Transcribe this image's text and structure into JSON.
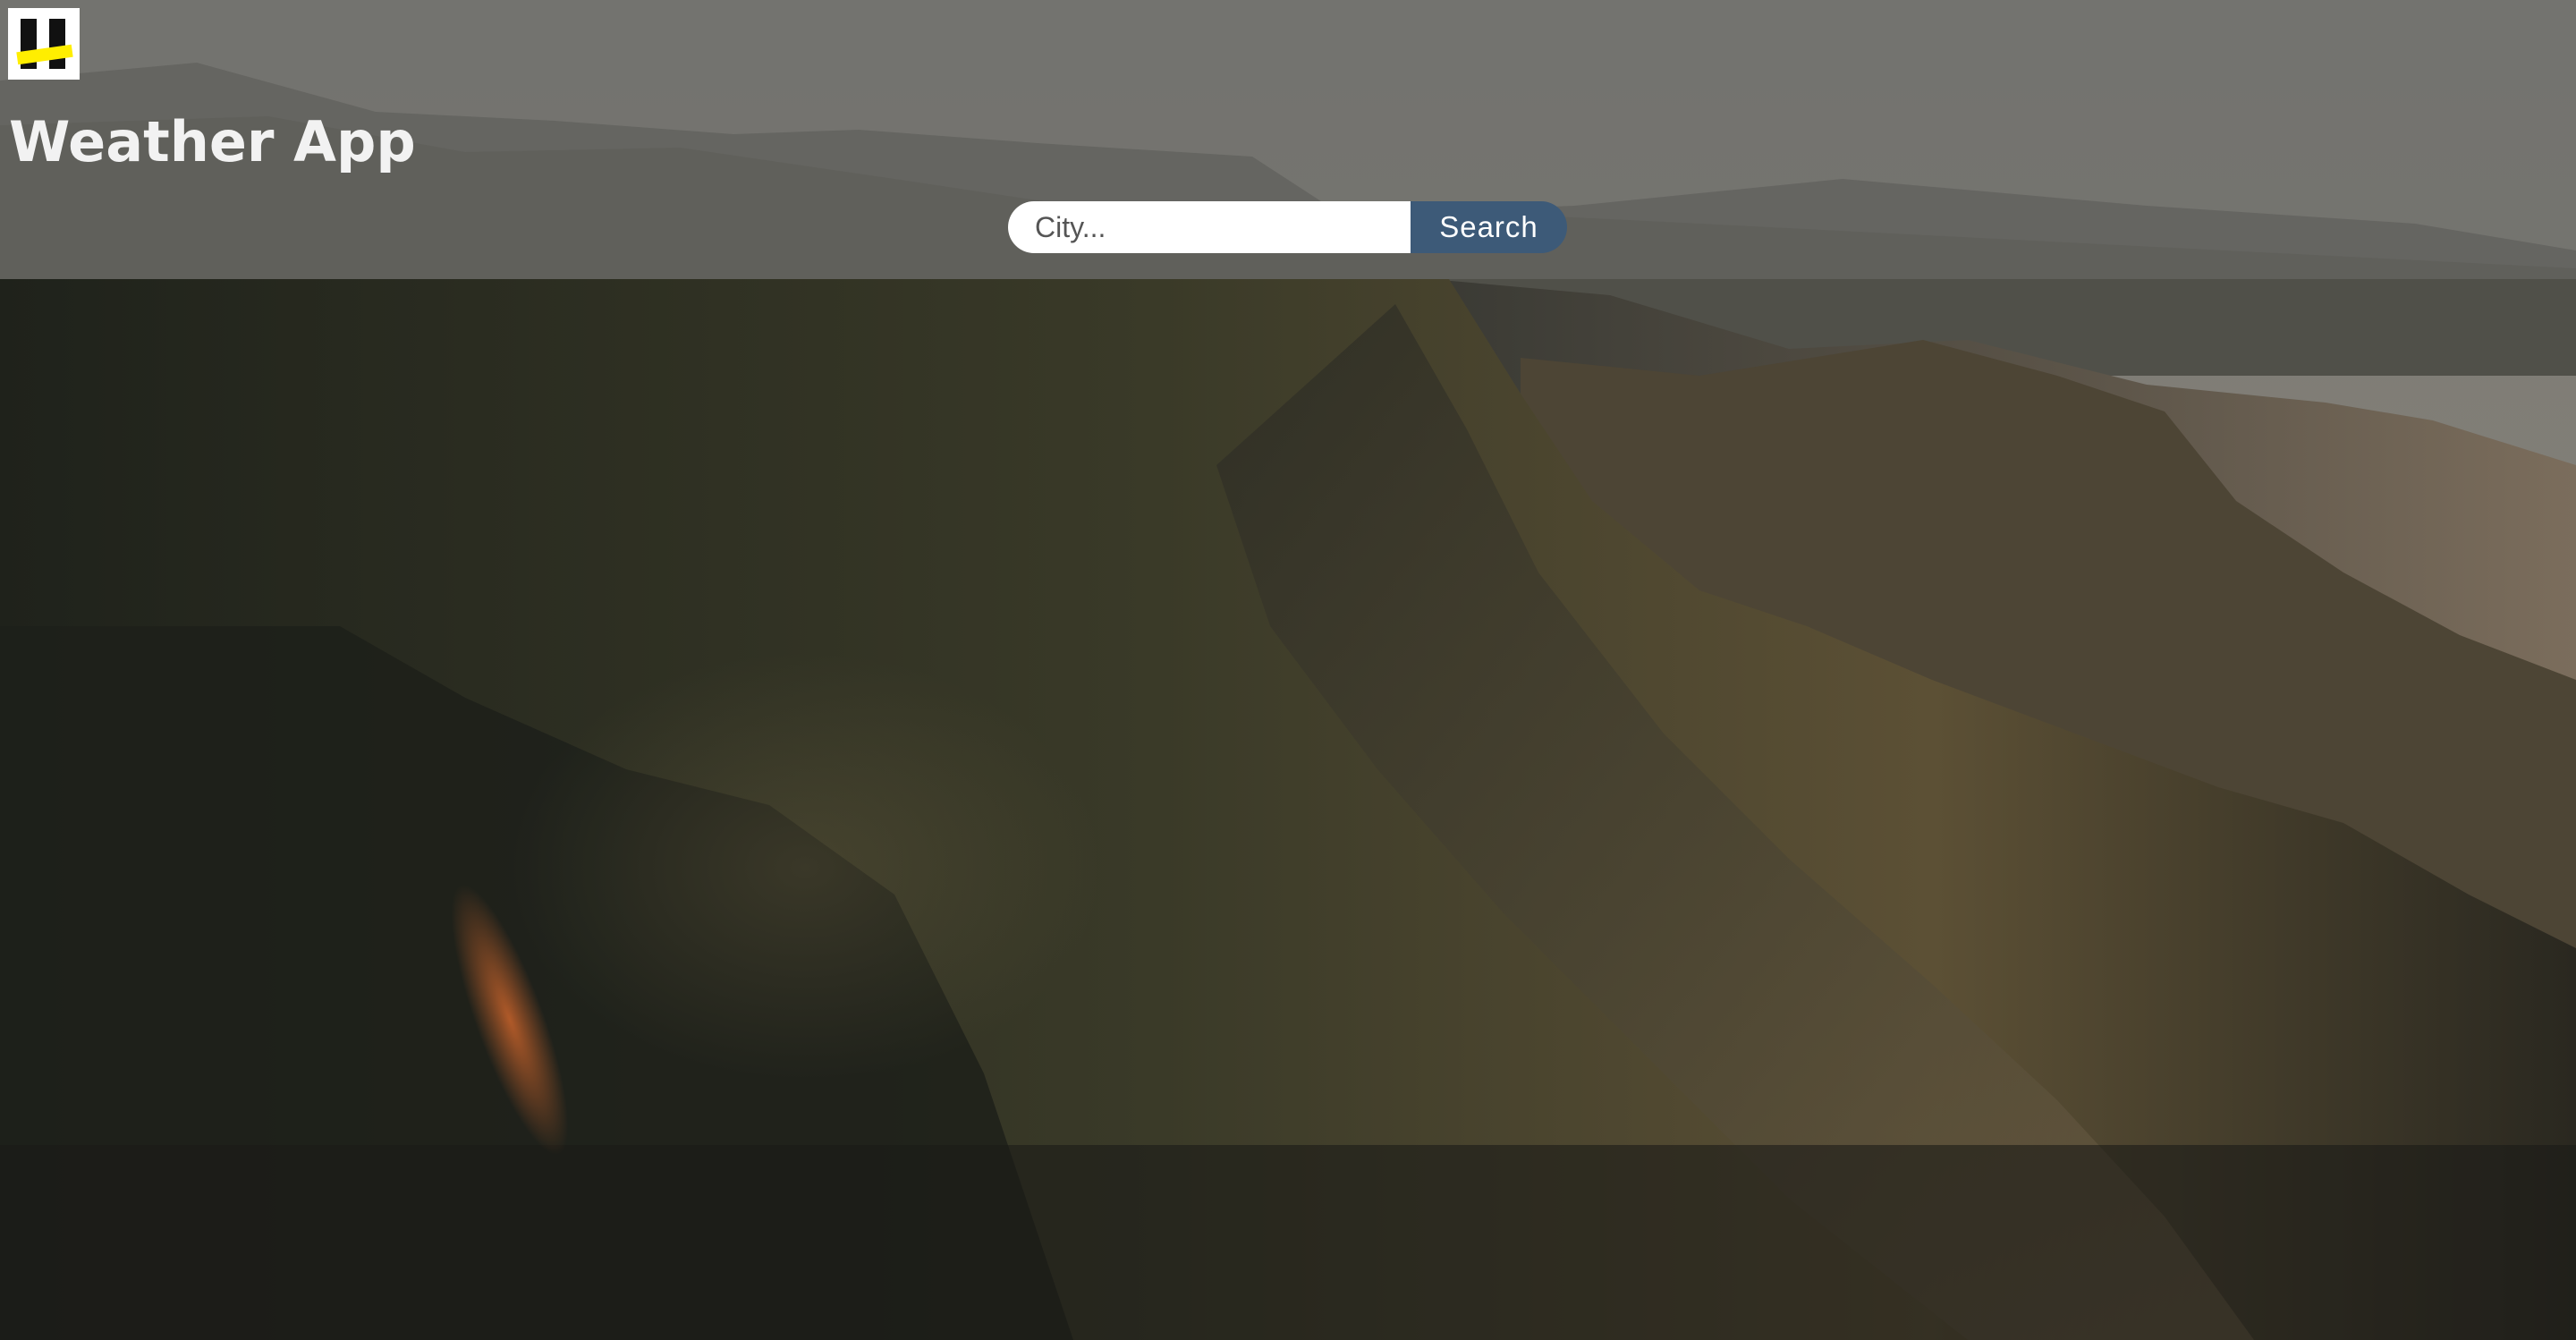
{
  "app": {
    "title": "Weather App",
    "logo_icon": "app-logo-icon"
  },
  "search": {
    "placeholder": "City...",
    "value": "",
    "button_label": "Search",
    "button_color": "#3d5a78"
  },
  "colors": {
    "header_overlay": "#6e6e6a",
    "title_text": "#f2f2f2",
    "logo_accent": "#ffee00"
  }
}
